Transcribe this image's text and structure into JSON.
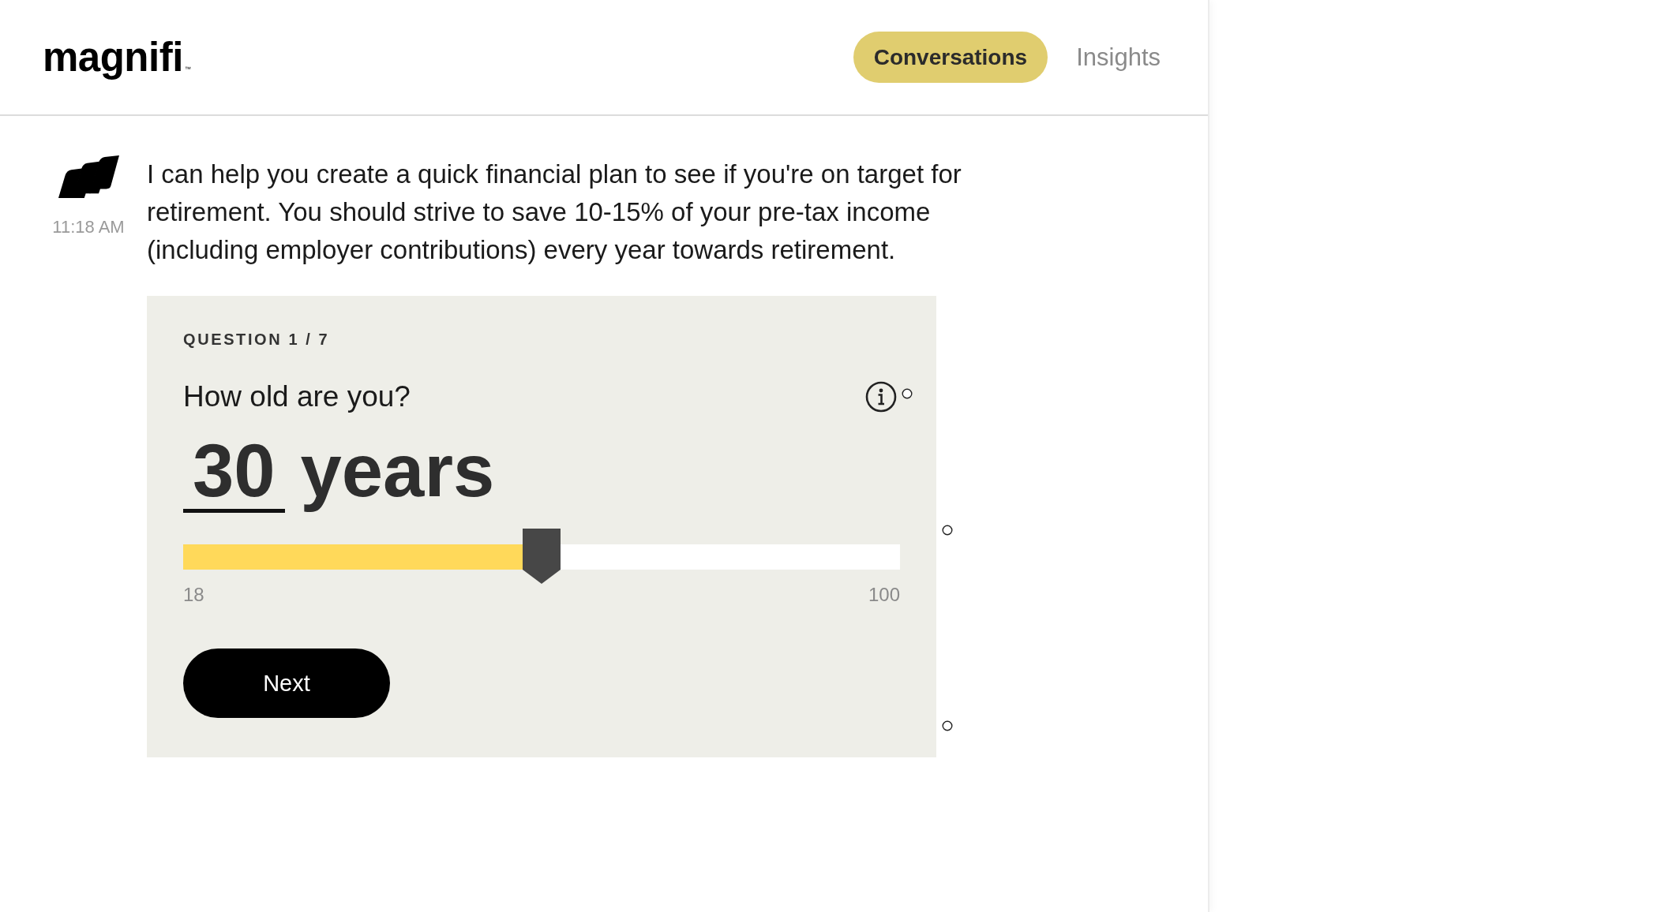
{
  "header": {
    "logo": "magnifi",
    "logo_mark": "™",
    "tabs": [
      {
        "label": "Conversations",
        "selected": true
      },
      {
        "label": "Insights",
        "selected": false
      }
    ]
  },
  "message": {
    "time": "11:18 AM",
    "text": "I can help you create a quick financial plan to see if you're on target for retirement. You should strive to save 10-15% of your pre-tax income (including employer contributions) every year towards retirement."
  },
  "question_card": {
    "counter": "QUESTION 1 / 7",
    "question": "How old are you?",
    "answer_value": "30",
    "answer_unit": "years",
    "slider": {
      "level": 0.5,
      "min_label": "18",
      "max_label": "100"
    },
    "button": "Next"
  }
}
